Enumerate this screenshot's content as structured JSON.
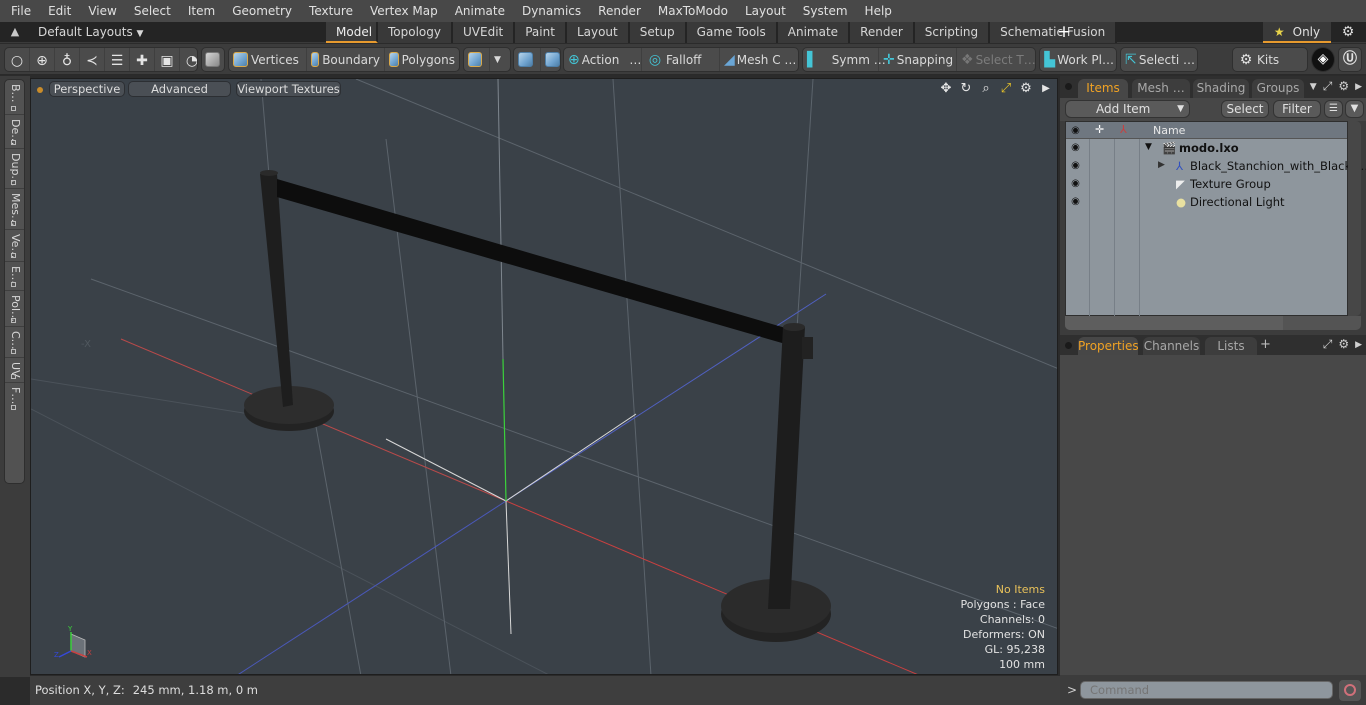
{
  "menubar": {
    "items": [
      "File",
      "Edit",
      "View",
      "Select",
      "Item",
      "Geometry",
      "Texture",
      "Vertex Map",
      "Animate",
      "Dynamics",
      "Render",
      "MaxToModo",
      "Layout",
      "System",
      "Help"
    ]
  },
  "layout_bar": {
    "layout_selector": "Default Layouts",
    "tabs": [
      "Model",
      "Topology",
      "UVEdit",
      "Paint",
      "Layout",
      "Setup",
      "Game Tools",
      "Animate",
      "Render",
      "Scripting",
      "Schematic Fusion"
    ],
    "active_tab": "Model",
    "add_tab_label": "+",
    "only_label": "Only"
  },
  "toolbar": {
    "vertices": "Vertices",
    "boundary": "Boundary",
    "polygons": "Polygons",
    "action": "Action",
    "action_more": "…",
    "falloff": "Falloff",
    "mesh_c": "Mesh C …",
    "symm": "Symm …",
    "snapping": "Snapping",
    "select_t": "Select T…",
    "work_pl": "Work Pl…",
    "selecti": "Selecti …",
    "kits": "Kits"
  },
  "left_palette": {
    "tabs": [
      "B…",
      "De…",
      "Dup…",
      "Mes…",
      "Ve…",
      "E…",
      "Pol…",
      "C…",
      "UV",
      "F…"
    ]
  },
  "viewport": {
    "view_mode": "Perspective",
    "shading": "Advanced",
    "textures": "Viewport Textures",
    "info": {
      "selection": "No Items",
      "polygons": "Polygons : Face",
      "channels": "Channels: 0",
      "deformers": "Deformers: ON",
      "gl": "GL: 95,238",
      "grid": "100 mm"
    },
    "gizmo_labels": {
      "x": "X",
      "y": "Y",
      "z": "Z"
    },
    "colors": {
      "background": "#3a4148",
      "x_axis": "#c84040",
      "y_axis": "#3bd13b",
      "z_axis": "#4050c8",
      "object": "#1c1c1c"
    }
  },
  "statusbar": {
    "position_label": "Position X, Y, Z:",
    "position_value": "245 mm, 1.18 m, 0 m"
  },
  "items_panel": {
    "tabs": [
      "Items",
      "Mesh …",
      "Shading",
      "Groups"
    ],
    "active_tab": "Items",
    "add_item": "Add Item",
    "select": "Select",
    "filter": "Filter",
    "column_name": "Name",
    "rows": [
      {
        "label": "modo.lxo",
        "type": "scene",
        "expanded": true
      },
      {
        "label": "Black_Stanchion_with_Black_ …",
        "type": "mesh-locator",
        "expanded": false
      },
      {
        "label": "Texture Group",
        "type": "texture-group"
      },
      {
        "label": "Directional Light",
        "type": "light"
      }
    ]
  },
  "properties_panel": {
    "tabs": [
      "Properties",
      "Channels",
      "Lists"
    ],
    "active_tab": "Properties",
    "add_label": "+"
  },
  "command": {
    "prompt": ">",
    "placeholder": "Command"
  },
  "accent_color": "#e79a2e"
}
